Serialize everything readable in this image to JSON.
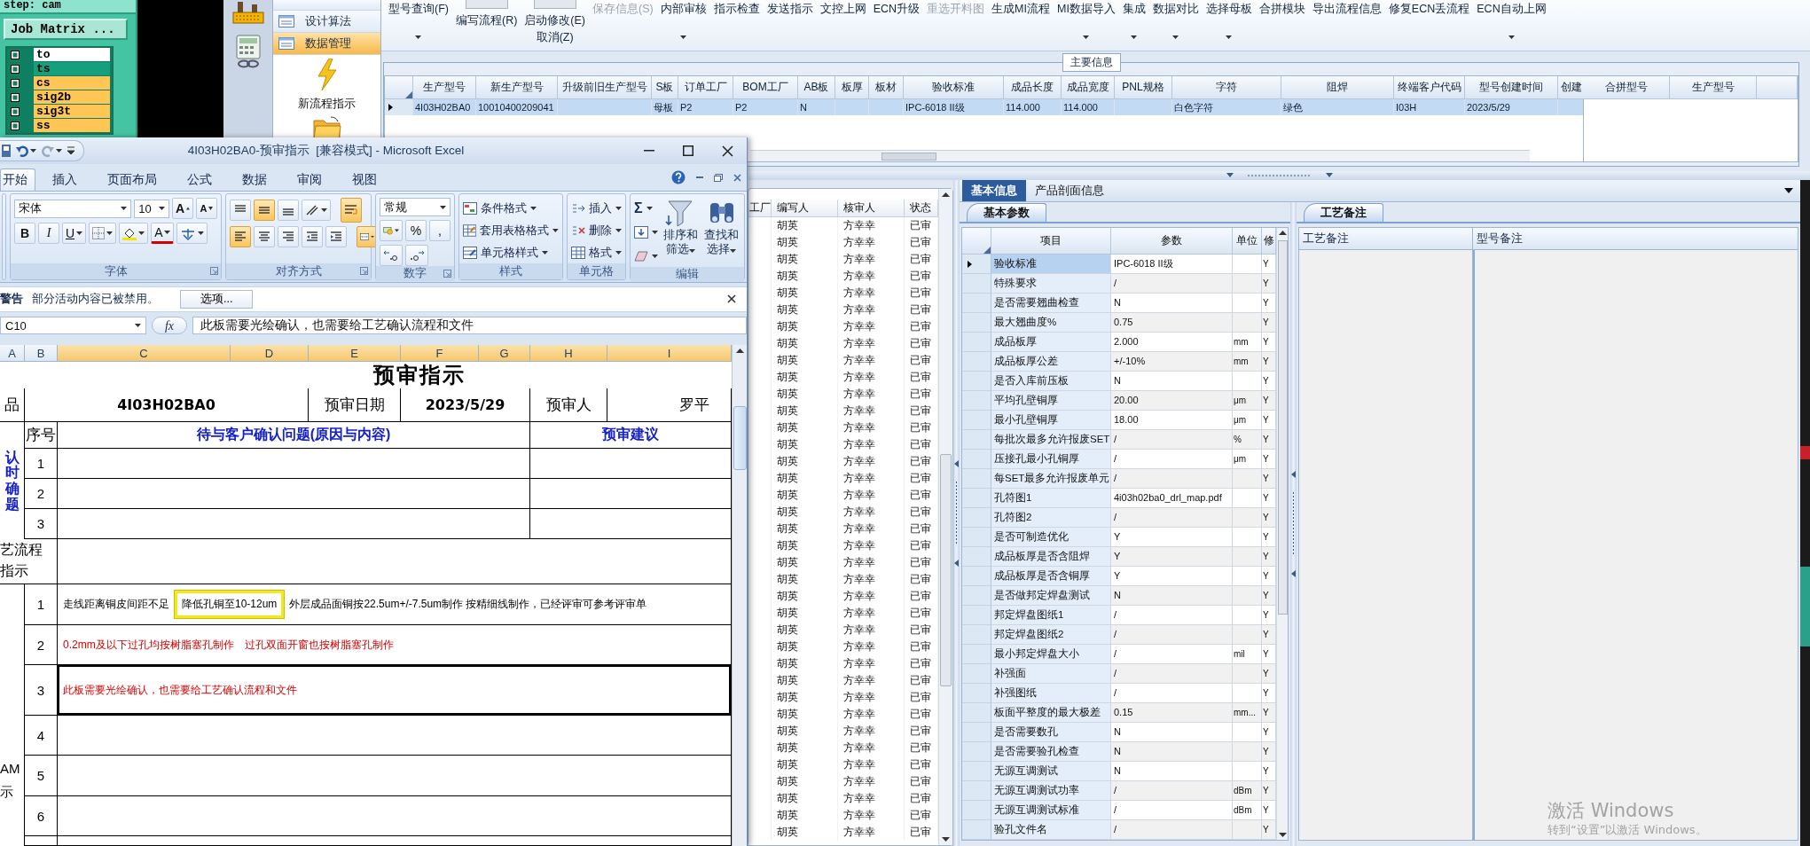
{
  "cam_panel": {
    "step": "step: cam",
    "matrix_button": "Job Matrix ...",
    "layers": [
      {
        "name": "to",
        "color": "#ffffff"
      },
      {
        "name": "ts",
        "color": "#14a07c"
      },
      {
        "name": "cs",
        "color": "#ffc655"
      },
      {
        "name": "sig2b",
        "color": "#ffc655"
      },
      {
        "name": "sig3t",
        "color": "#ffc655"
      },
      {
        "name": "ss",
        "color": "#ffc655"
      }
    ]
  },
  "nav": {
    "items": [
      {
        "label": "设计算法",
        "selected": false
      },
      {
        "label": "数据管理",
        "selected": true
      }
    ],
    "actions": [
      {
        "kind": "lightning",
        "label": "新流程指示"
      },
      {
        "kind": "folder"
      }
    ]
  },
  "toolbar": {
    "items": [
      {
        "label": "型号查询(F)",
        "kind": "plain",
        "dropdown": true,
        "disabled": false
      },
      {
        "label": "编写流程(R)",
        "kind": "switch",
        "switch_on": false,
        "dropdown": false,
        "disabled": false
      },
      {
        "label": "启动修改(E)",
        "sub_label": "取消(Z)",
        "kind": "switch",
        "switch_on": false,
        "dropdown": false,
        "disabled": false
      },
      {
        "label": "保存信息(S)",
        "kind": "plain",
        "dropdown": false,
        "disabled": true
      },
      {
        "label": "内部审核",
        "kind": "plain",
        "dropdown": true,
        "disabled": false
      },
      {
        "label": "指示检查",
        "kind": "plain",
        "dropdown": false,
        "disabled": false
      },
      {
        "label": "发送指示",
        "kind": "plain",
        "dropdown": false,
        "disabled": false
      },
      {
        "label": "文控上网",
        "kind": "plain",
        "dropdown": false,
        "disabled": false
      },
      {
        "label": "ECN升级",
        "kind": "plain",
        "dropdown": false,
        "disabled": false
      },
      {
        "label": "重选开料图",
        "kind": "plain",
        "dropdown": false,
        "disabled": true
      },
      {
        "label": "生成MI流程",
        "kind": "plain",
        "dropdown": false,
        "disabled": false
      },
      {
        "label": "MI数据导入",
        "kind": "plain",
        "dropdown": true,
        "disabled": false
      },
      {
        "label": "集成",
        "kind": "plain",
        "dropdown": true,
        "disabled": false
      },
      {
        "label": "数据对比",
        "kind": "plain",
        "dropdown": true,
        "disabled": false
      },
      {
        "label": "选择母板",
        "kind": "plain",
        "dropdown": true,
        "disabled": false
      },
      {
        "label": "合拼模块",
        "kind": "plain",
        "dropdown": false,
        "disabled": false
      },
      {
        "label": "导出流程信息",
        "kind": "plain",
        "dropdown": false,
        "disabled": false
      },
      {
        "label": "修复ECN丢流程",
        "kind": "plain",
        "dropdown": false,
        "disabled": false
      },
      {
        "label": "ECN自动上网",
        "kind": "plain",
        "dropdown": true,
        "disabled": false
      }
    ]
  },
  "main_info": {
    "title": "主要信息",
    "columns": [
      "生产型号",
      "新生产型号",
      "升级前旧生产型号",
      "S板",
      "订单工厂",
      "BOM工厂",
      "AB板",
      "板厚",
      "板材",
      "验收标准",
      "成品长度",
      "成品宽度",
      "PNL规格",
      "字符",
      "阻焊",
      "终端客户代码",
      "型号创建时间",
      "创建"
    ],
    "rows": [
      {
        "selected": true,
        "cells": [
          "4I03H02BA0",
          "10010400209041",
          null,
          "母板",
          "P2",
          "P2",
          "N",
          null,
          null,
          "IPC-6018 II级",
          "114.000",
          "114.000",
          null,
          "白色字符",
          "绿色",
          "I03H",
          "2023/5/29",
          null
        ]
      }
    ],
    "side_columns": [
      "合拼型号",
      "生产型号"
    ]
  },
  "record_list": {
    "columns": [
      "工厂",
      "编写人",
      "核审人",
      "状态"
    ],
    "rows": [
      {
        "author": "胡英",
        "reviewer": "方幸幸",
        "status": "已审"
      },
      {
        "author": "胡英",
        "reviewer": "方幸幸",
        "status": "已审"
      },
      {
        "author": "胡英",
        "reviewer": "方幸幸",
        "status": "已审"
      },
      {
        "author": "胡英",
        "reviewer": "方幸幸",
        "status": "已审"
      },
      {
        "author": "胡英",
        "reviewer": "方幸幸",
        "status": "已审"
      },
      {
        "author": "胡英",
        "reviewer": "方幸幸",
        "status": "已审"
      },
      {
        "author": "胡英",
        "reviewer": "方幸幸",
        "status": "已审"
      },
      {
        "author": "胡英",
        "reviewer": "方幸幸",
        "status": "已审"
      },
      {
        "author": "胡英",
        "reviewer": "方幸幸",
        "status": "已审"
      },
      {
        "author": "胡英",
        "reviewer": "方幸幸",
        "status": "已审"
      },
      {
        "author": "胡英",
        "reviewer": "方幸幸",
        "status": "已审"
      },
      {
        "author": "胡英",
        "reviewer": "方幸幸",
        "status": "已审"
      },
      {
        "author": "胡英",
        "reviewer": "方幸幸",
        "status": "已审"
      },
      {
        "author": "胡英",
        "reviewer": "方幸幸",
        "status": "已审"
      },
      {
        "author": "胡英",
        "reviewer": "方幸幸",
        "status": "已审"
      },
      {
        "author": "胡英",
        "reviewer": "方幸幸",
        "status": "已审"
      },
      {
        "author": "胡英",
        "reviewer": "方幸幸",
        "status": "已审"
      },
      {
        "author": "胡英",
        "reviewer": "方幸幸",
        "status": "已审"
      },
      {
        "author": "胡英",
        "reviewer": "方幸幸",
        "status": "已审"
      },
      {
        "author": "胡英",
        "reviewer": "方幸幸",
        "status": "已审"
      },
      {
        "author": "胡英",
        "reviewer": "方幸幸",
        "status": "已审"
      },
      {
        "author": "胡英",
        "reviewer": "方幸幸",
        "status": "已审"
      },
      {
        "author": "胡英",
        "reviewer": "方幸幸",
        "status": "已审"
      },
      {
        "author": "胡英",
        "reviewer": "方幸幸",
        "status": "已审"
      },
      {
        "author": "胡英",
        "reviewer": "方幸幸",
        "status": "已审"
      },
      {
        "author": "胡英",
        "reviewer": "方幸幸",
        "status": "已审"
      },
      {
        "author": "胡英",
        "reviewer": "方幸幸",
        "status": "已审"
      },
      {
        "author": "胡英",
        "reviewer": "方幸幸",
        "status": "已审"
      },
      {
        "author": "胡英",
        "reviewer": "方幸幸",
        "status": "已审"
      },
      {
        "author": "胡英",
        "reviewer": "方幸幸",
        "status": "已审"
      },
      {
        "author": "胡英",
        "reviewer": "方幸幸",
        "status": "已审"
      },
      {
        "author": "胡英",
        "reviewer": "方幸幸",
        "status": "已审"
      },
      {
        "author": "胡英",
        "reviewer": "方幸幸",
        "status": "已审"
      },
      {
        "author": "胡英",
        "reviewer": "方幸幸",
        "status": "已审"
      },
      {
        "author": "胡英",
        "reviewer": "方幸幸",
        "status": "已审"
      },
      {
        "author": "胡英",
        "reviewer": "方幸幸",
        "status": "已审"
      },
      {
        "author": "胡英",
        "reviewer": "方幸幸",
        "status": "已审"
      }
    ]
  },
  "detail_tabs": [
    {
      "label": "基本信息",
      "selected": true
    },
    {
      "label": "产品剖面信息",
      "selected": false
    }
  ],
  "params": {
    "subtabs": [
      {
        "label": "基本参数",
        "selected": true
      }
    ],
    "columns": [
      "项目",
      "参数",
      "单位",
      "修"
    ],
    "rows": [
      {
        "item": "验收标准",
        "value": "IPC-6018 II级",
        "flag": "Y",
        "selected": true
      },
      {
        "item": "特殊要求",
        "value": "/",
        "flag": "Y",
        "selected": false
      },
      {
        "item": "是否需要翘曲检查",
        "value": "N",
        "flag": "Y",
        "selected": false
      },
      {
        "item": "最大翘曲度%",
        "value": "0.75",
        "flag": "Y",
        "selected": false
      },
      {
        "item": "成品板厚",
        "value": "2.000",
        "unit": "mm",
        "flag": "Y",
        "selected": false
      },
      {
        "item": "成品板厚公差",
        "value": "+/-10%",
        "unit": "mm",
        "flag": "Y",
        "selected": false
      },
      {
        "item": "是否入库前压板",
        "value": "N",
        "flag": "Y",
        "selected": false
      },
      {
        "item": "平均孔壁铜厚",
        "value": "20.00",
        "unit": "μm",
        "flag": "Y",
        "selected": false
      },
      {
        "item": "最小孔壁铜厚",
        "value": "18.00",
        "unit": "μm",
        "flag": "Y",
        "selected": false
      },
      {
        "item": "每批次最多允许报废SET",
        "value": "/",
        "unit": "%",
        "flag": "Y",
        "selected": false
      },
      {
        "item": "压接孔最小孔铜厚",
        "value": "/",
        "unit": "μm",
        "flag": "Y",
        "selected": false
      },
      {
        "item": "每SET最多允许报废单元",
        "value": "/",
        "flag": "Y",
        "selected": false
      },
      {
        "item": "孔符图1",
        "value": "4i03h02ba0_drl_map.pdf",
        "flag": "Y",
        "selected": false
      },
      {
        "item": "孔符图2",
        "value": "/",
        "flag": "Y",
        "selected": false
      },
      {
        "item": "是否可制造优化",
        "value": "Y",
        "flag": "Y",
        "selected": false
      },
      {
        "item": "成品板厚是否含阻焊",
        "value": "Y",
        "flag": "Y",
        "selected": false
      },
      {
        "item": "成品板厚是否含铜厚",
        "value": "Y",
        "flag": "Y",
        "selected": false
      },
      {
        "item": "是否做邦定焊盘测试",
        "value": "N",
        "flag": "Y",
        "selected": false
      },
      {
        "item": "邦定焊盘图纸1",
        "value": "/",
        "flag": "Y",
        "selected": false
      },
      {
        "item": "邦定焊盘图纸2",
        "value": "/",
        "flag": "Y",
        "selected": false
      },
      {
        "item": "最小邦定焊盘大小",
        "value": "/",
        "unit": "mil",
        "flag": "Y",
        "selected": false
      },
      {
        "item": "补强面",
        "value": "/",
        "flag": "Y",
        "selected": false
      },
      {
        "item": "补强图纸",
        "value": "/",
        "flag": "Y",
        "selected": false
      },
      {
        "item": "板面平整度的最大极差",
        "value": "0.15",
        "unit": "mm...",
        "flag": "Y",
        "selected": false
      },
      {
        "item": "是否需要数孔",
        "value": "N",
        "flag": "Y",
        "selected": false
      },
      {
        "item": "是否需要验孔检查",
        "value": "N",
        "flag": "Y",
        "selected": false
      },
      {
        "item": "无源互调测试",
        "value": "N",
        "flag": "Y",
        "selected": false
      },
      {
        "item": "无源互调测试功率",
        "value": "/",
        "unit": "dBm",
        "flag": "Y",
        "selected": false
      },
      {
        "item": "无源互调测试标准",
        "value": "/",
        "unit": "dBm",
        "flag": "Y",
        "selected": false
      },
      {
        "item": "验孔文件名",
        "value": "/",
        "flag": "Y",
        "selected": false
      }
    ]
  },
  "remarks": {
    "subtabs": [
      {
        "label": "工艺备注",
        "selected": true
      }
    ],
    "columns": [
      "工艺备注",
      "型号备注"
    ]
  },
  "excel": {
    "title": "4I03H02BA0-预审指示  [兼容模式] - Microsoft Excel",
    "tabs": [
      {
        "label": "开始",
        "selected": true
      },
      {
        "label": "插入",
        "selected": false
      },
      {
        "label": "页面布局",
        "selected": false
      },
      {
        "label": "公式",
        "selected": false
      },
      {
        "label": "数据",
        "selected": false
      },
      {
        "label": "审阅",
        "selected": false
      },
      {
        "label": "视图",
        "selected": false
      }
    ],
    "ribbon": {
      "groups": [
        {
          "kind": "font",
          "label": "字体"
        },
        {
          "kind": "alignment",
          "label": "对齐方式"
        },
        {
          "kind": "number",
          "label": "数字"
        },
        {
          "kind": "styles",
          "label": "样式"
        },
        {
          "kind": "cells",
          "label": "单元格"
        },
        {
          "kind": "editing",
          "label": "编辑"
        }
      ],
      "font_name": "宋体",
      "font_size": "10",
      "font_size_buttons": [
        "A",
        "A"
      ],
      "format_buttons": [
        "B",
        "I",
        "U"
      ],
      "font_color_button": "A",
      "alignment": {
        "vertical": [
          {
            "kind": "top",
            "selected": false
          },
          {
            "kind": "middle",
            "selected": true
          },
          {
            "kind": "bottom",
            "selected": false
          }
        ],
        "horizontal": [
          {
            "kind": "left",
            "selected": true
          },
          {
            "kind": "center",
            "selected": false
          },
          {
            "kind": "right",
            "selected": false
          }
        ],
        "wrap_text": true,
        "merged": true
      },
      "number_format": "常规",
      "number_buttons": [
        "%",
        ","
      ],
      "style_buttons": [
        "条件格式",
        "套用表格格式",
        "单元格样式"
      ],
      "cell_buttons": [
        "插入",
        "删除",
        "格式"
      ],
      "sum_button": "Σ",
      "edit_buttons": [
        "排序和筛选",
        "查找和选择"
      ]
    },
    "security_bar": {
      "label": "警告",
      "message": "部分活动内容已被禁用。",
      "button": "选项..."
    },
    "formula_bar": {
      "cell": "C10",
      "function_label": "fx",
      "formula": "此板需要光绘确认，也需要给工艺确认流程和文件"
    },
    "sheet": {
      "columns": [
        {
          "label": "A",
          "selected": false
        },
        {
          "label": "B",
          "selected": false
        },
        {
          "label": "C",
          "selected": true
        },
        {
          "label": "D",
          "selected": true
        },
        {
          "label": "E",
          "selected": true
        },
        {
          "label": "F",
          "selected": true
        },
        {
          "label": "G",
          "selected": true
        },
        {
          "label": "H",
          "selected": true
        },
        {
          "label": "I",
          "selected": true
        }
      ],
      "title": "预审指示",
      "part_label": "品",
      "part_no": "4I03H02BA0",
      "date_label": "预审日期",
      "date": "2023/5/29",
      "reviewer_label": "预审人",
      "reviewer": "罗平",
      "seq_label": "序号",
      "issue_label": "待与客户确认问题(原因与内容)",
      "advice_label": "预审建议",
      "question_side_label": "认时确题",
      "questions": [
        "1",
        "2",
        "3"
      ],
      "process_label_lines": [
        "艺流程",
        "指示"
      ],
      "instruction_side_lines": [
        "AM",
        "示"
      ],
      "instructions": [
        {
          "no": "1",
          "selected": false,
          "warning": false,
          "segments": [
            {
              "text": "走线距离铜皮间距不足",
              "highlight": false
            },
            {
              "text": "降低孔铜至10-12um",
              "highlight": true
            },
            {
              "text": "外层成品面铜按22.5um+/-7.5um制作 按精细线制作，已经评审可参考评审单",
              "highlight": false
            }
          ]
        },
        {
          "no": "2",
          "selected": false,
          "warning": true,
          "segments": [
            {
              "text": "0.2mm及以下过孔均按树脂塞孔制作",
              "highlight": false
            },
            {
              "text": "过孔双面开窗也按树脂塞孔制作",
              "highlight": false
            }
          ]
        },
        {
          "no": "3",
          "selected": true,
          "warning": true,
          "segments": [
            {
              "text": "此板需要光绘确认，也需要给工艺确认流程和文件",
              "highlight": false
            }
          ]
        },
        {
          "no": "4",
          "selected": false
        },
        {
          "no": "5",
          "selected": false
        },
        {
          "no": "6",
          "selected": false
        }
      ]
    }
  },
  "os_watermark": {
    "title": "激活 Windows",
    "hint": "转到“设置”以激活 Windows。"
  }
}
